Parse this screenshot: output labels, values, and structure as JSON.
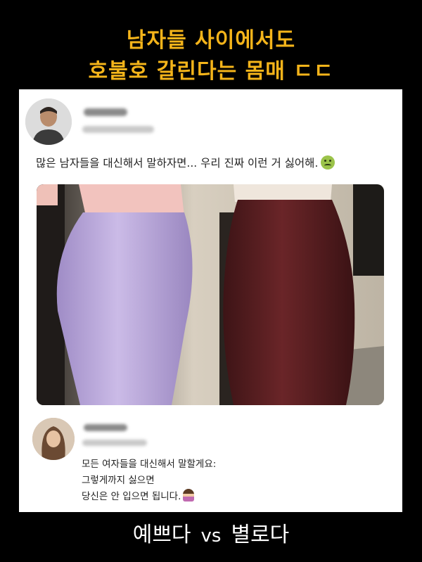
{
  "headline": {
    "line1": "남자들 사이에서도",
    "line2": "호불호 갈린다는 몸매 ㄷㄷ"
  },
  "post": {
    "author_name": "",
    "author_handle": "",
    "text": "많은 남자들을 대신해서 말하자면... 우리 진짜 이런 거 싫어해.",
    "emoji": "nauseated-face-icon"
  },
  "photo": {
    "skirt_left_color": "#b9a6d8",
    "skirt_right_color": "#5a1f22",
    "top_left_color": "#f2c3be",
    "top_right_color": "#efe6dc"
  },
  "reply": {
    "author_name": "",
    "author_handle": "",
    "lines": [
      "모든 여자들을 대신해서 말할게요:",
      "그렇게까지 싫으면",
      "당신은 안 입으면 됩니다."
    ],
    "emoji": "person-tipping-hand-icon"
  },
  "caption": {
    "left": "예쁘다",
    "vs": "vs",
    "right": "별로다"
  },
  "colors": {
    "headline": "#f4b41a",
    "background": "#000000",
    "card": "#ffffff"
  }
}
